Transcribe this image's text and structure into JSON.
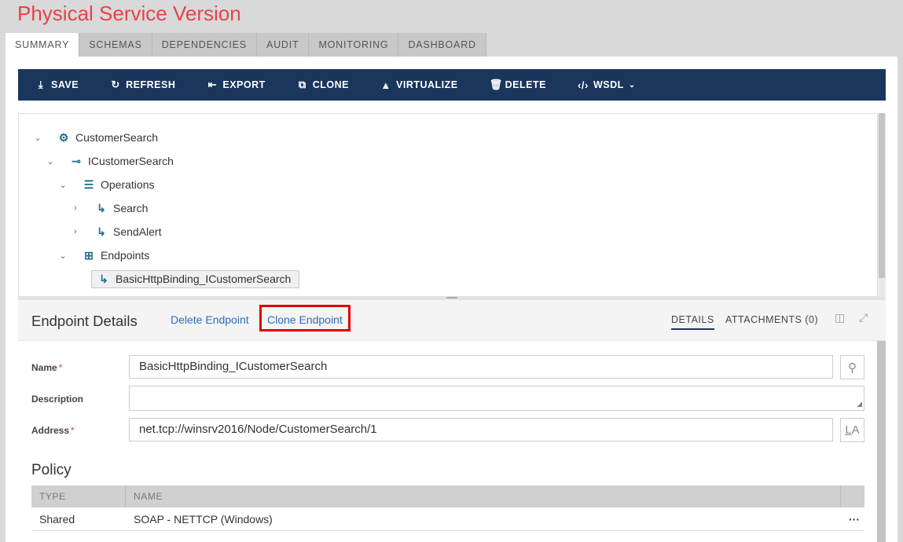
{
  "page_title": "Physical Service Version",
  "tabs": [
    {
      "label": "SUMMARY"
    },
    {
      "label": "SCHEMAS"
    },
    {
      "label": "DEPENDENCIES"
    },
    {
      "label": "AUDIT"
    },
    {
      "label": "MONITORING"
    },
    {
      "label": "DASHBOARD"
    }
  ],
  "toolbar": {
    "save": "SAVE",
    "refresh": "REFRESH",
    "export": "EXPORT",
    "clone": "CLONE",
    "virtualize": "VIRTUALIZE",
    "delete": "DELETE",
    "wsdl": "WSDL"
  },
  "tree": {
    "service": "CustomerSearch",
    "interface": "ICustomerSearch",
    "operations": "Operations",
    "op1": "Search",
    "op2": "SendAlert",
    "endpoints": "Endpoints",
    "endpoint1": "BasicHttpBinding_ICustomerSearch"
  },
  "details": {
    "title": "Endpoint Details",
    "delete_link": "Delete Endpoint",
    "clone_link": "Clone Endpoint",
    "tab_details": "DETAILS",
    "tab_attachments": "ATTACHMENTS (0)"
  },
  "form": {
    "name_label": "Name",
    "name_value": "BasicHttpBinding_ICustomerSearch",
    "description_label": "Description",
    "description_value": "",
    "address_label": "Address",
    "address_value": "net.tcp://winsrv2016/Node/CustomerSearch/1",
    "required_mark": "*"
  },
  "policy": {
    "title": "Policy",
    "columns": [
      "TYPE",
      "NAME"
    ],
    "rows": [
      {
        "type": "Shared",
        "name": "SOAP - NETTCP (Windows)",
        "actions": "···"
      }
    ]
  },
  "colors": {
    "title": "#e8424a",
    "toolbar": "#1b365d",
    "link": "#2a6ebb",
    "highlight": "#e00000"
  }
}
